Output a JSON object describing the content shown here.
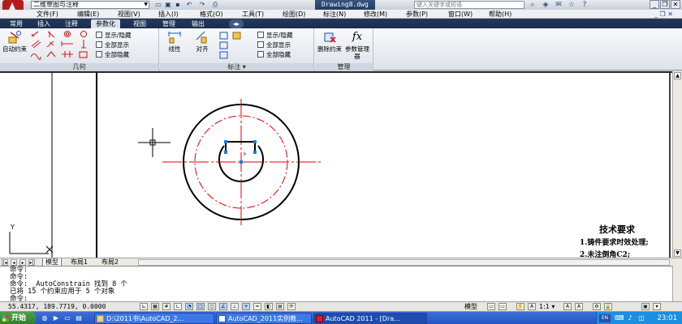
{
  "titlebar": {
    "workspace": "二维草图与注释",
    "document_title": "Drawing8.dwg",
    "help_placeholder": "键入关键字或短语"
  },
  "menubar": {
    "items": [
      "文件(F)",
      "编辑(E)",
      "视图(V)",
      "插入(I)",
      "格式(O)",
      "工具(T)",
      "绘图(D)",
      "标注(N)",
      "修改(M)",
      "参数(P)",
      "窗口(W)",
      "帮助(H)"
    ]
  },
  "ribbon_tabs": {
    "items": [
      "常用",
      "插入",
      "注释",
      "参数化",
      "视图",
      "管理",
      "输出"
    ],
    "active": "参数化"
  },
  "ribbon": {
    "geometry": {
      "title": "几何",
      "auto_constrain": "自动约束",
      "show_hide": "显示/隐藏",
      "show_all": "全部显示",
      "hide_all": "全部隐藏"
    },
    "dimensional": {
      "title": "标注",
      "linear": "线性",
      "aligned": "对齐",
      "show_hide": "显示/隐藏",
      "show_all": "全部显示",
      "hide_all": "全部隐藏"
    },
    "manage": {
      "title": "管理",
      "delete_constraints": "删除约束",
      "parameters_manager": "参数管理器"
    }
  },
  "drawing": {
    "notes_title": "技术要求",
    "note_1": "1.铸件要求时效处理;",
    "note_2": "2.未注倒角C2;",
    "ucs_y": "Y"
  },
  "layout_tabs": {
    "items": [
      "模型",
      "布局1",
      "布局2"
    ],
    "active": "模型"
  },
  "command_window": {
    "lines": [
      "命令:",
      "命令:",
      "命令: _AutoConstrain 找到 8 个",
      "已将 15 个约束应用于 5 个对象"
    ],
    "prompt": "命令:"
  },
  "statusbar": {
    "coordinates": "55.4317, 189.7719, 0.0000",
    "model_label": "模型",
    "scale": "1:1"
  },
  "taskbar": {
    "start_label": "开始",
    "tasks": [
      "D:\\2011书\\AutoCAD_2...",
      "AutoCAD_2011实例教...",
      "AutoCAD 2011 - [Dra..."
    ],
    "clock": "23:01",
    "lang": "EN"
  },
  "colors": {
    "ribbon_tab_bar": "#1a2d4b",
    "taskbar_blue": "#2456c4",
    "centerline_red": "#e00000",
    "constraint_blue": "#1a7fe0"
  }
}
